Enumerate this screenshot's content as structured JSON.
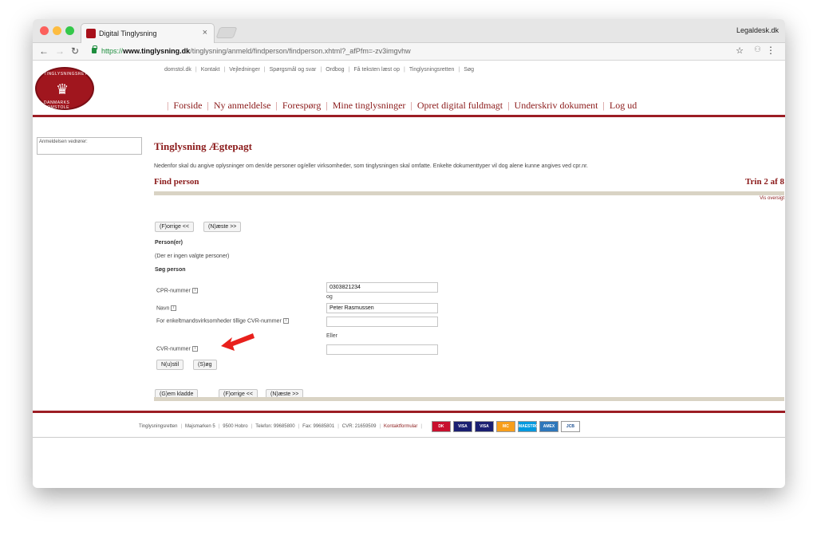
{
  "browser": {
    "tab_title": "Digital Tinglysning",
    "tab_close": "×",
    "profile_name": "Legaldesk.dk",
    "url_scheme": "https://",
    "url_host": "www.tinglysning.dk",
    "url_path": "/tinglysning/anmeld/findperson/findperson.xhtml?_afPfm=-zv3imgvhw"
  },
  "site": {
    "top_links": [
      "domstol.dk",
      "Kontakt",
      "Vejledninger",
      "Spørgsmål og svar",
      "Ordbog",
      "Få teksten læst op",
      "Tinglysningsretten",
      "Søg"
    ],
    "main_nav": [
      "Forside",
      "Ny anmeldelse",
      "Forespørg",
      "Mine tinglysninger",
      "Opret digital fuldmagt",
      "Underskriv dokument",
      "Log ud"
    ],
    "logo_top": "TINGLYSNINGSRETTEN",
    "logo_bottom": "DANMARKS DOMSTOLE",
    "accent_color": "#8b1a1a"
  },
  "sidebar": {
    "box_label": "Anmeldelsen vedrører:"
  },
  "main": {
    "title": "Tinglysning Ægtepagt",
    "intro": "Nedenfor skal du angive oplysninger om den/de personer og/eller virksomheder, som tinglysningen skal omfatte. Enkelte dokumenttyper vil dog alene kunne angives ved cpr.nr.",
    "section_title": "Find person",
    "step": "Trin 2 af 8",
    "overview_link": "Vis oversigt",
    "prev_button": "(F)orrige <<",
    "next_button": "(N)æste >>",
    "persons_heading": "Person(er)",
    "persons_empty": "(Der er ingen valgte personer)",
    "search_heading": "Søg person",
    "cpr_label": "CPR-nummer",
    "cpr_value": "0303821234",
    "og_text": "og",
    "name_label": "Navn",
    "name_value": "Peter Rasmussen",
    "cvr_extra_label": "For enkeltmandsvirksomheder tillige CVR-nummer",
    "cvr_extra_value": "",
    "eller_text": "Eller",
    "cvr_label": "CVR-nummer",
    "cvr_value": "",
    "reset_button": "N(u)stil",
    "search_button": "(S)øg",
    "save_draft_button": "(G)em kladde"
  },
  "footer": {
    "items": [
      "Tinglysningsretten",
      "Majsmarken 5",
      "9500 Hobro",
      "Telefon: 99685800",
      "Fax: 99685801",
      "CVR: 21659509"
    ],
    "contact": "Kontaktformular",
    "cards": [
      "DK",
      "VISA",
      "VISA",
      "MC",
      "MAESTRO",
      "AMEX",
      "JCB"
    ]
  },
  "annotation": {
    "arrow_color": "#e8201c"
  }
}
